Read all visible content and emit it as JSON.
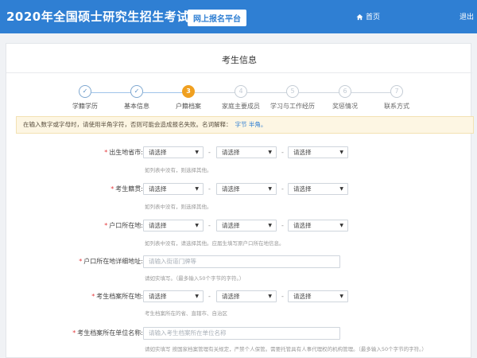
{
  "header": {
    "brand": "2020年全国硕士研究生招生考试",
    "platform": "网上报名平台",
    "home": "首页",
    "exit": "退出"
  },
  "panel": {
    "title": "考生信息"
  },
  "steps": [
    {
      "num": "✓",
      "label": "学籍学历"
    },
    {
      "num": "✓",
      "label": "基本信息"
    },
    {
      "num": "3",
      "label": "户籍档案"
    },
    {
      "num": "4",
      "label": "家庭主要成员"
    },
    {
      "num": "5",
      "label": "学习与工作经历"
    },
    {
      "num": "6",
      "label": "奖惩情况"
    },
    {
      "num": "7",
      "label": "联系方式"
    }
  ],
  "notice": {
    "text": "在输入数字或字母时，请使用半角字符，否则可能会造成报名失败。名词解释：",
    "link": "字节 半角。"
  },
  "select_placeholder": "请选择",
  "fields": {
    "birthplace": {
      "label": "出生地省市:",
      "hint": "如列表中没有，则选择其他。"
    },
    "native": {
      "label": "考生籍贯:",
      "hint": "如列表中没有，则选择其他。"
    },
    "hukou": {
      "label": "户口所在地:",
      "hint": "如列表中没有，请选择其他。应届生填写原户口所在地信息。"
    },
    "hukou_address": {
      "label": "户口所在地详细地址:",
      "placeholder": "请输入街道门牌等",
      "hint": "请如实填写。（最多输入50个字节的字符。）"
    },
    "archive": {
      "label": "考生档案所在地:",
      "hint": "考生档案所在的省、直辖市、自治区"
    },
    "archive_unit": {
      "label": "考生档案所在单位名称:",
      "placeholder": "请输入考生档案所在单位名称",
      "hint": "请如实填写 按国家档案管理有关规定，严禁个人保管。需要托管具有人事代理权的机构管理。（最多输入50个字节的字符。）"
    }
  }
}
